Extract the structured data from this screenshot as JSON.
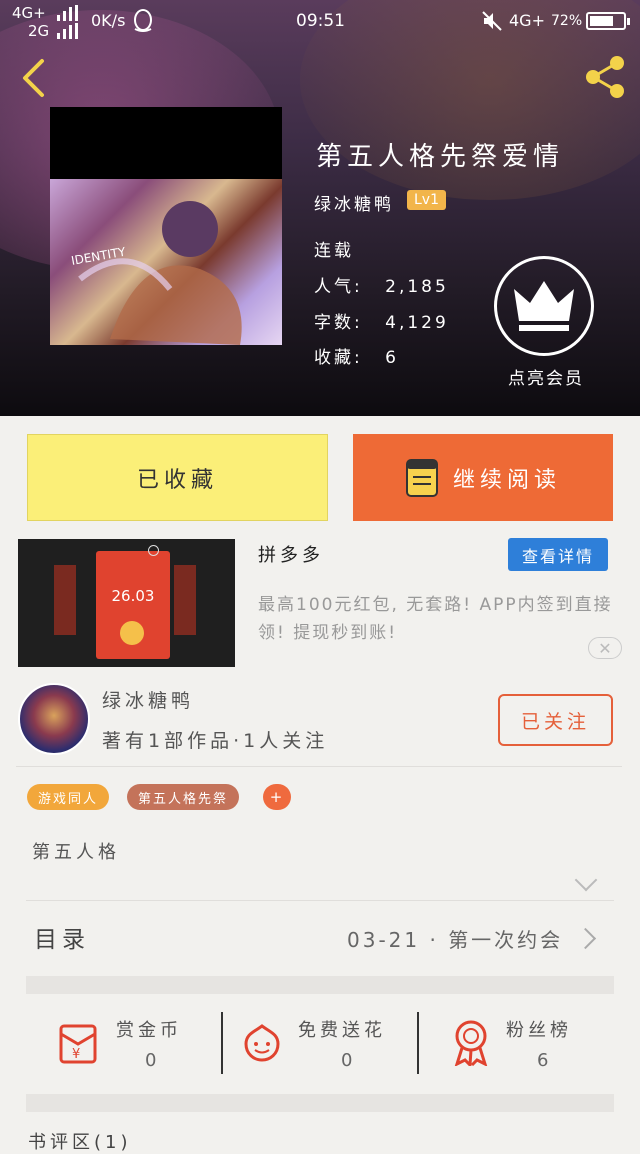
{
  "status_bar": {
    "network_left": "4G+",
    "network_left2": "2G",
    "speed": "0K/s",
    "time": "09:51",
    "network_right": "4G+",
    "battery": "72%",
    "battery_level": 0.72
  },
  "book": {
    "title": "第五人格先祭爱情",
    "author": "绿冰糖鸭",
    "level": "Lv1",
    "status": "连载",
    "popularity_label": "人气:",
    "popularity": "2,185",
    "words_label": "字数:",
    "words": "4,129",
    "favorites_label": "收藏:",
    "favorites": "6",
    "vip_label": "点亮会员"
  },
  "actions": {
    "favorited_label": "已收藏",
    "continue_label": "继续阅读"
  },
  "ad": {
    "image_amount": "26.03",
    "title": "拼多多",
    "button": "查看详情",
    "description": "最高100元红包, 无套路! APP内签到直接领! 提现秒到账!"
  },
  "author_card": {
    "name": "绿冰糖鸭",
    "stats": "著有1部作品·1人关注",
    "follow_label": "已关注"
  },
  "tags": [
    {
      "label": "游戏同人",
      "color": "#f2a73b"
    },
    {
      "label": "第五人格先祭",
      "color": "#c4735a"
    },
    {
      "label": "+",
      "color": "#ef6a3e"
    }
  ],
  "description": "第五人格",
  "toc": {
    "label": "目录",
    "latest": "03-21 · 第一次约会"
  },
  "stats": [
    {
      "label": "赏金币",
      "value": "0",
      "icon": "red-envelope-icon"
    },
    {
      "label": "免费送花",
      "value": "0",
      "icon": "flower-icon"
    },
    {
      "label": "粉丝榜",
      "value": "6",
      "icon": "medal-icon"
    }
  ],
  "bottom_partial": "书评区(1)"
}
